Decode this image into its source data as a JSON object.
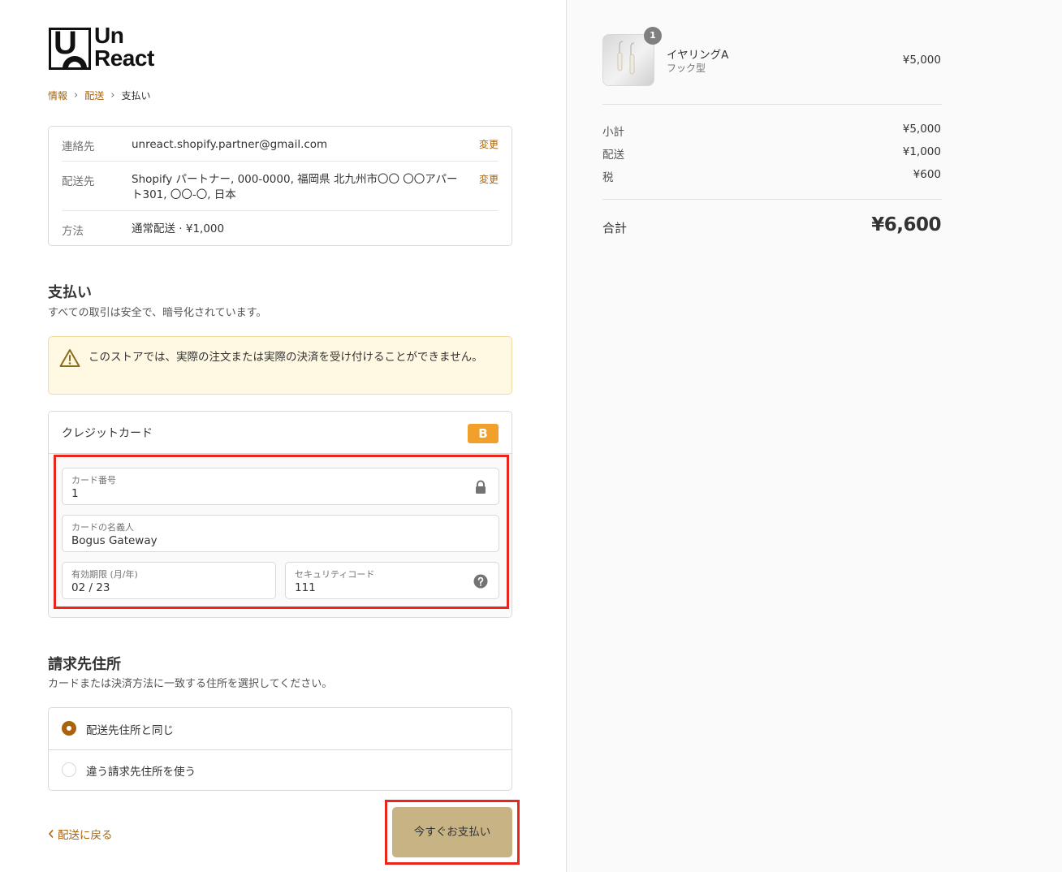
{
  "logo": {
    "line1": "Un",
    "line2": "React"
  },
  "breadcrumb": {
    "step1": "情報",
    "step2": "配送",
    "step3": "支払い",
    "separator": "›"
  },
  "review": {
    "contact_label": "連絡先",
    "contact_value": "unreact.shopify.partner@gmail.com",
    "ship_label": "配送先",
    "ship_value": "Shopify パートナー, 000-0000, 福岡県 北九州市〇〇 〇〇アパート301, 〇〇-〇, 日本",
    "method_label": "方法",
    "method_value": "通常配送 · ¥1,000",
    "change_label": "変更"
  },
  "payment": {
    "title": "支払い",
    "subtitle": "すべての取引は安全で、暗号化されています。",
    "warning": "このストアでは、実際の注文または実際の決済を受け付けることができません。",
    "card_label": "クレジットカード",
    "card_brand": "B",
    "card_number_label": "カード番号",
    "card_number_value": "1",
    "name_label": "カードの名義人",
    "name_value": "Bogus Gateway",
    "expiry_label": "有効期限 (月/年)",
    "expiry_value": "02 / 23",
    "cvv_label": "セキュリティコード",
    "cvv_value": "111"
  },
  "billing": {
    "title": "請求先住所",
    "subtitle": "カードまたは決済方法に一致する住所を選択してください。",
    "option_same": "配送先住所と同じ",
    "option_different": "違う請求先住所を使う",
    "selected": "same"
  },
  "actions": {
    "back_label": "配送に戻る",
    "pay_label": "今すぐお支払い"
  },
  "summary": {
    "product_name": "イヤリングA",
    "product_variant": "フック型",
    "product_qty": "1",
    "product_price": "¥5,000",
    "subtotal_label": "小計",
    "subtotal_value": "¥5,000",
    "shipping_label": "配送",
    "shipping_value": "¥1,000",
    "tax_label": "税",
    "tax_value": "¥600",
    "total_label": "合計",
    "total_value": "¥6,600"
  },
  "colors": {
    "accent": "#a8630c",
    "pay_button": "#c8b384",
    "highlight": "#e8261b",
    "warning_bg": "#fff8e2",
    "card_brand_bg": "#f0a02b"
  }
}
